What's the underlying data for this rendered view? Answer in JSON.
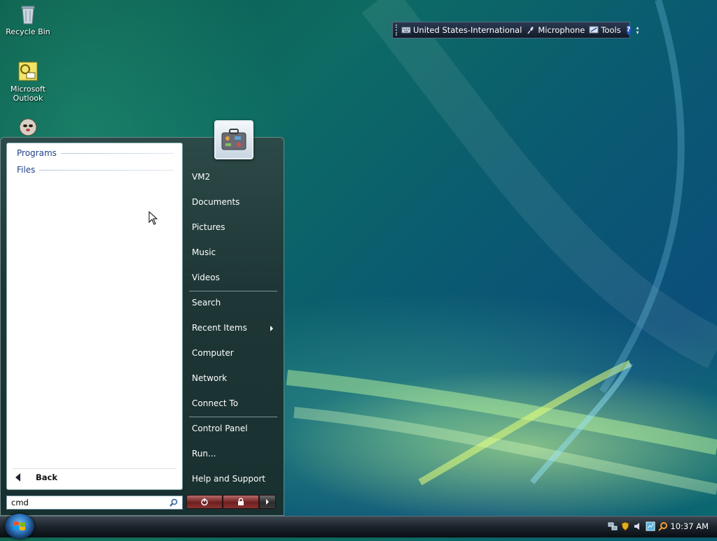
{
  "desktop": {
    "icons": [
      {
        "label": "Recycle Bin",
        "icon": "recycle-bin-icon"
      },
      {
        "label": "Microsoft Outlook",
        "icon": "outlook-icon"
      },
      {
        "label": "",
        "icon": "mascot-shortcut-icon"
      }
    ]
  },
  "language_bar": {
    "language": "United States-International",
    "microphone": "Microphone",
    "tools": "Tools",
    "help": "?"
  },
  "start_menu": {
    "left_pane": {
      "sections": [
        "Programs",
        "Files"
      ],
      "back_label": "Back"
    },
    "search": {
      "value": "cmd"
    },
    "right_pane": {
      "items": [
        {
          "label": "VM2"
        },
        {
          "label": "Documents"
        },
        {
          "label": "Pictures"
        },
        {
          "label": "Music"
        },
        {
          "label": "Videos"
        },
        {
          "label": "Search"
        },
        {
          "label": "Recent Items",
          "has_submenu": true
        },
        {
          "label": "Computer"
        },
        {
          "label": "Network"
        },
        {
          "label": "Connect To"
        },
        {
          "label": "Control Panel"
        },
        {
          "label": "Run..."
        },
        {
          "label": "Help and Support"
        }
      ]
    }
  },
  "taskbar": {
    "clock": "10:37 AM"
  },
  "colors": {
    "power_button": "#8a2a2a",
    "section_header": "#1d3f88",
    "taskbar": "#1a222a"
  }
}
